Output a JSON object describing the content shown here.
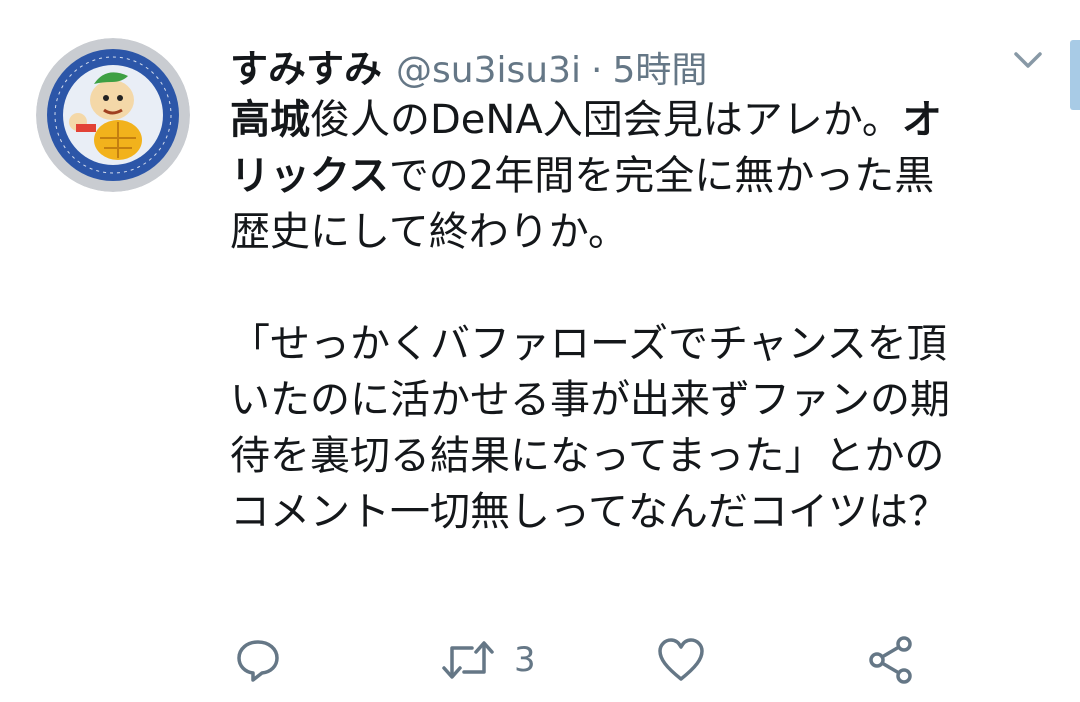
{
  "tweet": {
    "display_name": "すみすみ",
    "handle": "@su3isu3i",
    "separator": "·",
    "time": "5時間",
    "lines": [
      {
        "bold": "高城",
        "rest": "俊人のDeNA入団会見はアレか。",
        "bold2": "オ"
      },
      {
        "bold": "リックス",
        "rest": "での2年間を完全に無かった黒"
      },
      {
        "text": "歴史にして終わりか。"
      },
      {
        "text": "「せっかくバファローズでチャンスを頂"
      },
      {
        "text": "いたのに活かせる事が出来ずファンの期"
      },
      {
        "text": "待を裏切る結果になってまった」とかの"
      },
      {
        "text": "コメント一切無しってなんだコイツは？"
      }
    ]
  },
  "actions": {
    "reply_icon": "reply-icon",
    "retweet_icon": "retweet-icon",
    "retweet_count": "3",
    "like_icon": "heart-icon",
    "share_icon": "share-icon"
  },
  "colors": {
    "text": "#14171a",
    "secondary": "#657786",
    "icon": "#657786"
  }
}
